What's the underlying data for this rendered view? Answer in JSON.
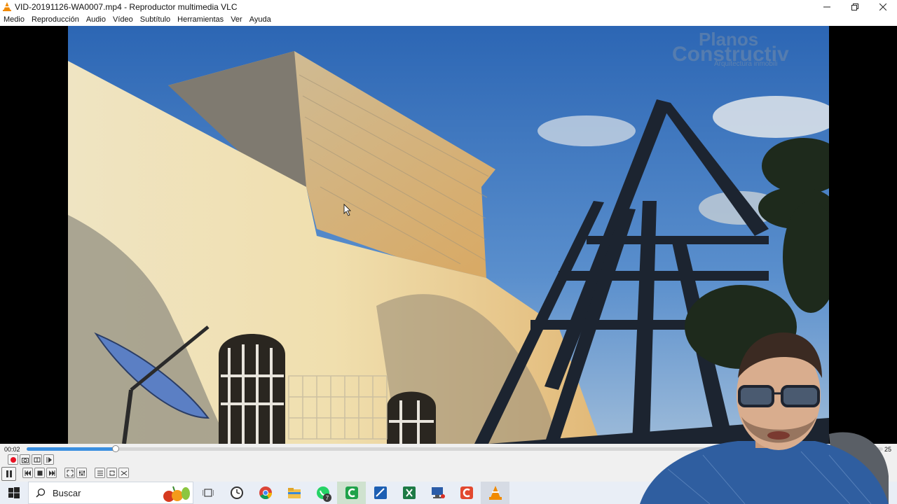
{
  "window": {
    "title": "VID-20191126-WA0007.mp4 - Reproductor multimedia VLC"
  },
  "menu": [
    {
      "label": "Medio"
    },
    {
      "label": "Reproducción"
    },
    {
      "label": "Audio"
    },
    {
      "label": "Vídeo"
    },
    {
      "label": "Subtítulo"
    },
    {
      "label": "Herramientas"
    },
    {
      "label": "Ver"
    },
    {
      "label": "Ayuda"
    }
  ],
  "video": {
    "watermark_line1": "Planos",
    "watermark_line2": "Constructiv",
    "watermark_line3": "Arquitectura  inmobili"
  },
  "player": {
    "time_elapsed": "00:02",
    "time_total": "25",
    "progress_fraction": 0.104
  },
  "taskbar": {
    "search_placeholder": "Buscar",
    "whatsapp_badge": "7"
  },
  "colors": {
    "accent": "#3a8fe0",
    "record": "#e81123",
    "taskbar_bg": "#e9eef6",
    "sky": "#4f88c8",
    "wall": "#e8d9b0"
  },
  "icons": [
    "vlc-icon",
    "minimize-icon",
    "restore-icon",
    "close-icon",
    "record-icon",
    "snapshot-icon",
    "loop-ab-icon",
    "frame-step-icon",
    "pause-icon",
    "previous-icon",
    "stop-icon",
    "next-icon",
    "fullscreen-icon",
    "extended-settings-icon",
    "playlist-icon",
    "loop-icon",
    "shuffle-icon",
    "windows-start-icon",
    "search-icon",
    "fruit-icon",
    "task-view-icon",
    "clock-app-icon",
    "chrome-icon",
    "file-explorer-icon",
    "whatsapp-icon",
    "camtasia-icon",
    "sketch-app-icon",
    "excel-icon",
    "computer-app-icon",
    "camtasia-recorder-icon",
    "vlc-taskbar-icon"
  ]
}
